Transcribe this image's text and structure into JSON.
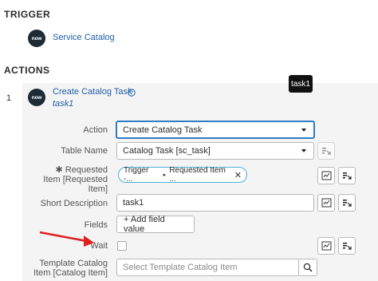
{
  "trigger": {
    "heading": "TRIGGER",
    "logo_text": "now",
    "name": "Service Catalog"
  },
  "actions": {
    "heading": "ACTIONS",
    "item": {
      "index": "1",
      "logo_text": "now",
      "title": "Create Catalog Task",
      "subtitle": "task1",
      "tooltip": "task1"
    },
    "fields": {
      "action": {
        "label": "Action",
        "value": "Create Catalog Task"
      },
      "table_name": {
        "label": "Table Name",
        "value": "Catalog Task [sc_task]"
      },
      "requested_item": {
        "label_line1": "✱ Requested",
        "label_line2": "Item [Requested",
        "label_line3": "Item]",
        "pill_left": "Trigger -...",
        "pill_right": "Requested Item ..."
      },
      "short_description": {
        "label": "Short Description",
        "value": "task1"
      },
      "fields_row": {
        "label": "Fields",
        "button": "+ Add field value"
      },
      "wait": {
        "label": "Wait",
        "checked": false
      },
      "template": {
        "label_line1": "Template Catalog",
        "label_line2": "Item [Catalog Item]",
        "placeholder": "Select Template Catalog Item"
      }
    }
  },
  "colors": {
    "accent": "#2f7cc7",
    "pill_border": "#48b3d6",
    "arrow": "#e02020",
    "link": "#1f5fa7"
  }
}
